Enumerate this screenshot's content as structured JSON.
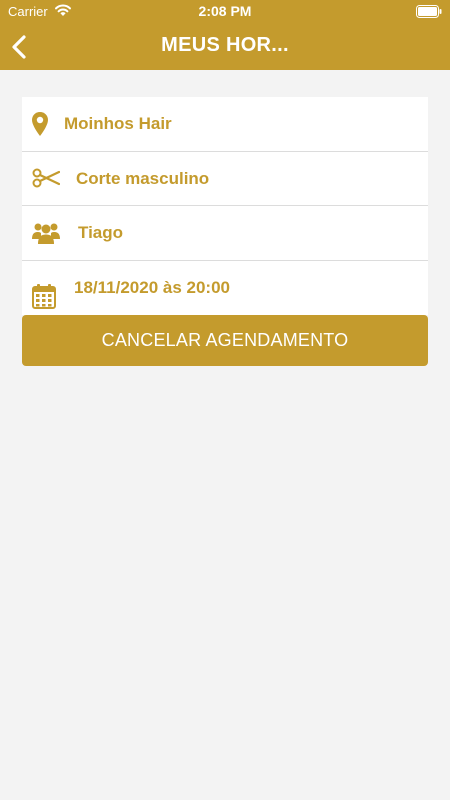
{
  "status_bar": {
    "carrier": "Carrier",
    "time": "2:08 PM"
  },
  "header": {
    "title": "MEUS HOR..."
  },
  "appointment": {
    "salon": "Moinhos Hair",
    "service": "Corte masculino",
    "professional": "Tiago",
    "datetime": "18/11/2020 às 20:00"
  },
  "actions": {
    "cancel_label": "CANCELAR AGENDAMENTO"
  },
  "colors": {
    "accent": "#c49b2d",
    "background": "#f3f3f3"
  },
  "icons": {
    "back": "chevron-left-icon",
    "salon": "location-pin-icon",
    "service": "scissors-icon",
    "professional": "people-icon",
    "datetime": "calendar-icon"
  }
}
